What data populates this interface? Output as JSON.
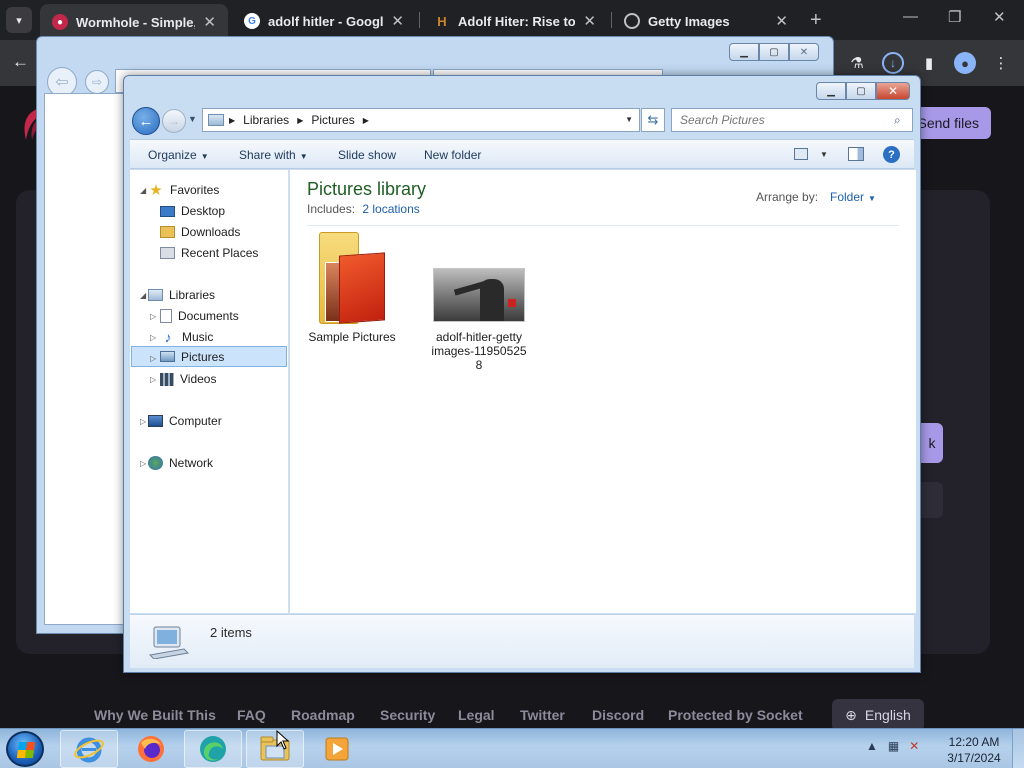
{
  "browser": {
    "tabs": [
      {
        "title": "Wormhole - Simple, p",
        "favicon_color": "#c3274a"
      },
      {
        "title": "adolf hitler - Google S",
        "favicon_color": "#ffffff"
      },
      {
        "title": "Adolf Hiter: Rise to Po",
        "favicon_color": "#c9852a"
      },
      {
        "title": "Getty Images",
        "favicon_color": "#bdc1c6"
      }
    ],
    "close_glyph": "✕",
    "new_tab_glyph": "+"
  },
  "page": {
    "send_button": "Send files",
    "card_button": "k",
    "footer_links": [
      "Why We Built This",
      "FAQ",
      "Roadmap",
      "Security",
      "Legal",
      "Twitter",
      "Discord",
      "Protected by Socket"
    ],
    "language": "English",
    "accent_color": "#a899e8"
  },
  "explorer": {
    "breadcrumb": [
      "Libraries",
      "Pictures"
    ],
    "search_placeholder": "Search Pictures",
    "commands": [
      "Organize",
      "Share with",
      "Slide show",
      "New folder"
    ],
    "nav": {
      "favorites": "Favorites",
      "favorites_items": [
        "Desktop",
        "Downloads",
        "Recent Places"
      ],
      "libraries": "Libraries",
      "libraries_items": [
        "Documents",
        "Music",
        "Pictures",
        "Videos"
      ],
      "selected": "Pictures",
      "computer": "Computer",
      "network": "Network"
    },
    "library_title": "Pictures library",
    "includes_label": "Includes:",
    "includes_link": "2 locations",
    "arrange_label": "Arrange by:",
    "arrange_value": "Folder",
    "items": [
      {
        "name": "Sample Pictures",
        "type": "folder"
      },
      {
        "name": "adolf-hitler-getty images-11950525 8",
        "type": "image"
      }
    ],
    "status": "2 items"
  },
  "taskbar": {
    "apps": [
      "internet-explorer",
      "firefox",
      "edge",
      "windows-explorer",
      "media-player"
    ],
    "time": "12:20 AM",
    "date": "3/17/2024"
  }
}
